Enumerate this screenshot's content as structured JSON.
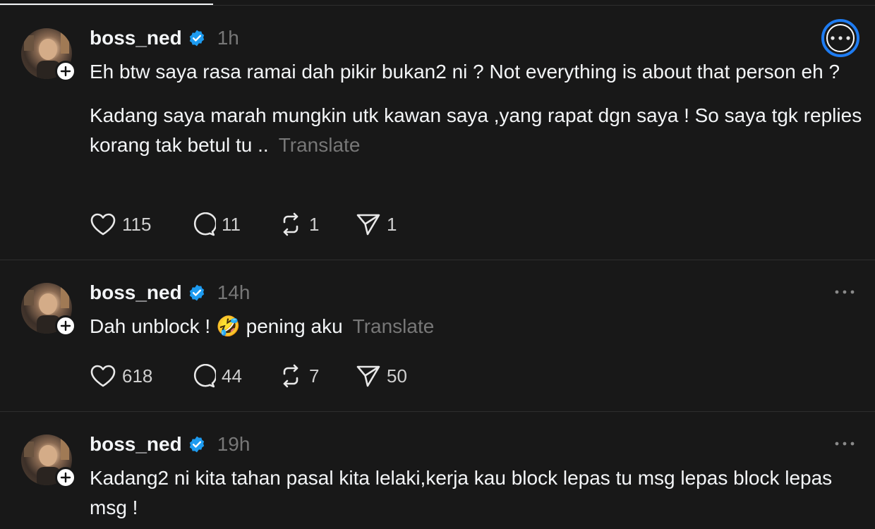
{
  "posts": [
    {
      "username": "boss_ned",
      "time": "1h",
      "paragraphs": [
        "Eh btw saya rasa ramai dah pikir bukan2 ni ? Not everything is about that person eh ?",
        "Kadang saya marah mungkin utk kawan saya ,yang rapat dgn saya ! So saya tgk replies korang tak betul tu .."
      ],
      "translate_label": "Translate",
      "likes": "115",
      "replies": "11",
      "reposts": "1",
      "shares": "1"
    },
    {
      "username": "boss_ned",
      "time": "14h",
      "paragraphs": [
        "Dah unblock ! 🤣 pening aku"
      ],
      "translate_label": "Translate",
      "likes": "618",
      "replies": "44",
      "reposts": "7",
      "shares": "50"
    },
    {
      "username": "boss_ned",
      "time": "19h",
      "paragraphs": [
        "Kadang2 ni kita tahan pasal kita lelaki,kerja kau block lepas tu msg lepas block lepas msg !"
      ]
    }
  ],
  "icons": {
    "verified": "verified-badge-icon",
    "like": "heart-icon",
    "reply": "comment-icon",
    "repost": "repost-icon",
    "share": "send-icon",
    "more": "more-icon",
    "follow": "plus-icon"
  },
  "colors": {
    "background": "#181818",
    "text": "#f3f5f7",
    "muted": "#777777",
    "verified": "#1d9bf0",
    "focus_ring": "#1e7cf2"
  }
}
